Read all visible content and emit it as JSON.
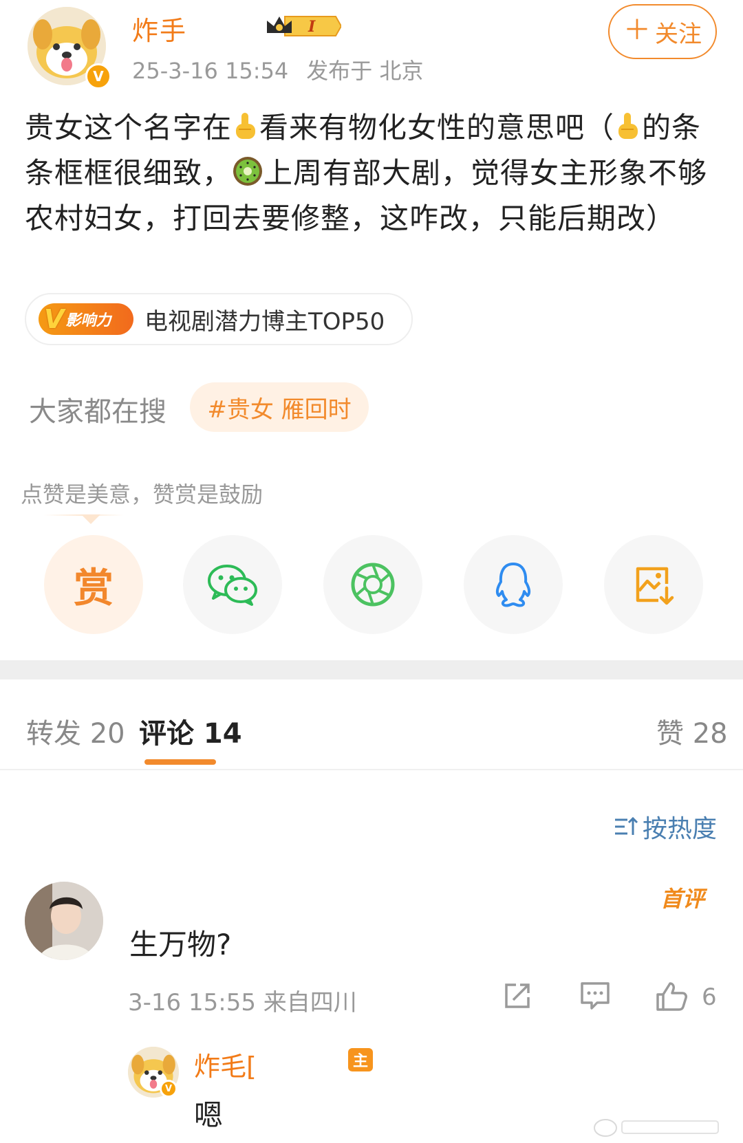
{
  "post": {
    "username": "炸手",
    "level_badge": "I",
    "timestamp": "25-3-16 15:54",
    "location": "发布于 北京",
    "follow_label": "关注",
    "text_parts": [
      "贵女这个名字在",
      "看来有物化女性的意思吧（",
      "的条条框框很细致，",
      "上周有部大剧，觉得女主形象不够农村妇女，打回去要修整，这咋改，只能后期改）"
    ],
    "influence_tag": "影响力",
    "influence_text": "电视剧潜力博主TOP50",
    "search_label": "大家都在搜",
    "search_chip": "#贵女 雁回时",
    "reward_tip": "点赞是美意，赞赏是鼓励",
    "reward_label": "赏",
    "share_icons": [
      "reward-icon",
      "wechat-icon",
      "moments-icon",
      "qq-icon",
      "save-image-icon"
    ]
  },
  "tabs": {
    "repost": "转发 20",
    "comments": "评论 14",
    "likes": "赞 28"
  },
  "sort_label": "按热度",
  "comment": {
    "first_badge": "首评",
    "text": "生万物?",
    "meta": "3-16 15:55  来自四川",
    "like_count": "6",
    "reply": {
      "username": "炸毛[",
      "author_badge": "主",
      "text": "嗯"
    }
  },
  "colors": {
    "accent": "#f28a2c",
    "link_blue": "#4a7fb1",
    "muted": "#999999"
  }
}
